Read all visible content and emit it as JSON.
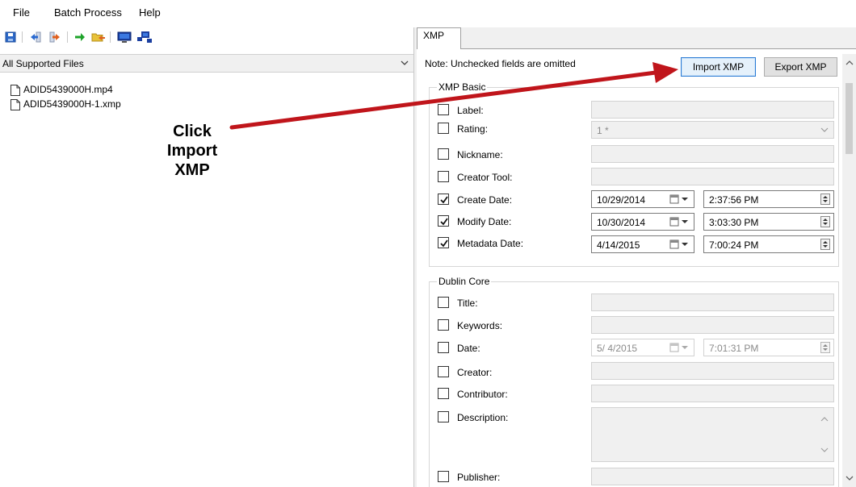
{
  "menu": {
    "file": "File",
    "batch": "Batch Process",
    "help": "Help"
  },
  "toolbar": {
    "icons": [
      "save-icon",
      "move-left-icon",
      "move-right-icon",
      "green-arrow-icon",
      "open-folder-icon",
      "monitor-icon",
      "network-icon"
    ]
  },
  "left": {
    "filter": "All Supported Files",
    "files": [
      "ADID5439000H.mp4",
      "ADID5439000H-1.xmp"
    ]
  },
  "tab": {
    "label": "XMP"
  },
  "note": "Note: Unchecked fields are omitted",
  "buttons": {
    "import": "Import XMP",
    "export": "Export XMP"
  },
  "xmp_basic": {
    "title": "XMP Basic",
    "label": "Label:",
    "rating": "Rating:",
    "rating_value": "1 *",
    "nickname": "Nickname:",
    "creator_tool": "Creator Tool:",
    "create_date": "Create Date:",
    "create_date_value": "10/29/2014",
    "create_time_value": "2:37:56 PM",
    "modify_date": "Modify Date:",
    "modify_date_value": "10/30/2014",
    "modify_time_value": "3:03:30 PM",
    "metadata_date": "Metadata Date:",
    "metadata_date_value": "4/14/2015",
    "metadata_time_value": "7:00:24 PM"
  },
  "dublin_core": {
    "title": "Dublin Core",
    "dc_title": "Title:",
    "keywords": "Keywords:",
    "date": "Date:",
    "date_value": "5/  4/2015",
    "time_value": "7:01:31 PM",
    "creator": "Creator:",
    "contributor": "Contributor:",
    "description": "Description:",
    "publisher": "Publisher:"
  },
  "callout": {
    "line1": "Click",
    "line2": "Import",
    "line3": "XMP"
  },
  "colors": {
    "arrow": "#c0151b",
    "accent_border": "#2a7bd4"
  }
}
